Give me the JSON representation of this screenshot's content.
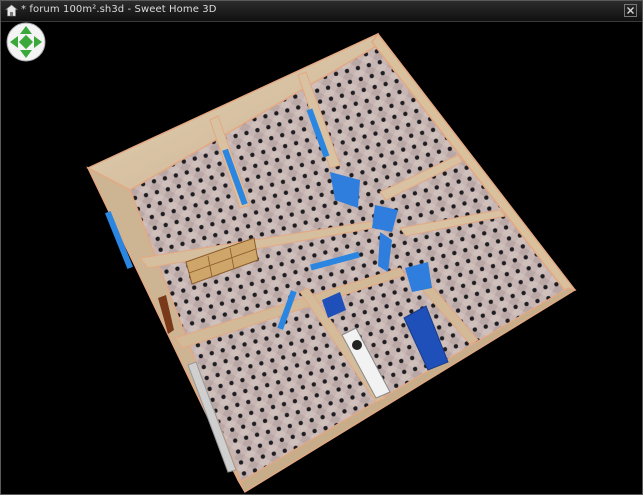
{
  "window": {
    "title": "* forum 100m².sh3d - Sweet Home 3D"
  },
  "icons": {
    "app": "sweet-home-3d-app-icon",
    "close": "close-icon",
    "navigation": "navigation-arrows-icon"
  },
  "view": {
    "type": "3D aerial view",
    "scene": "house plan with tiled floors, walls, doors, windows and furniture"
  },
  "colors": {
    "background": "#000000",
    "wall": "#d8c2a2",
    "wall_edge": "#e0a880",
    "floor": "#c4b4b0",
    "floor_tile": "#2a2a2a",
    "window": "#2a86e0",
    "sofa": "#1f4fb8",
    "nav_control": "#3aa83a"
  }
}
